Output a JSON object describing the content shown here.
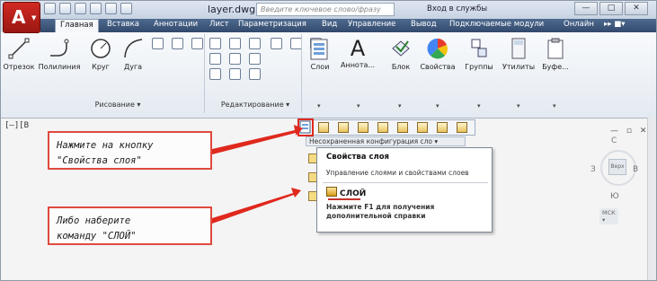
{
  "app": {
    "logo_letter": "A",
    "document_title": "layer.dwg",
    "search_placeholder": "Введите ключевое слово/фразу",
    "sign_in": "Вход в службы",
    "window_controls": [
      "—",
      "□",
      "✕"
    ]
  },
  "tabs": [
    {
      "label": "Главная",
      "active": true
    },
    {
      "label": "Вставка"
    },
    {
      "label": "Аннотации"
    },
    {
      "label": "Лист"
    },
    {
      "label": "Параметризация"
    },
    {
      "label": "Вид"
    },
    {
      "label": "Управление"
    },
    {
      "label": "Вывод"
    },
    {
      "label": "Подключаемые модули"
    },
    {
      "label": "Онлайн"
    }
  ],
  "ribbon": {
    "draw_tools": [
      "Отрезок",
      "Полилиния",
      "Круг",
      "Дуга"
    ],
    "draw_group_label": "Рисование ▾",
    "edit_group_label": "Редактирование ▾",
    "big_tools": [
      "Слои",
      "Аннота...",
      "Блок",
      "Свойства",
      "Группы",
      "Утилиты",
      "Буфе..."
    ],
    "icons": {
      "line": "line-icon",
      "polyline": "polyline-icon",
      "circle": "circle-icon",
      "arc": "arc-icon",
      "layers": "layers-icon",
      "annotation": "text-a-icon",
      "block": "block-icon",
      "properties": "color-wheel-icon",
      "groups": "groups-icon",
      "utilities": "calculator-icon",
      "clipboard": "clipboard-icon"
    }
  },
  "drawing": {
    "corner_label": "[–][В",
    "viewcube": {
      "top": "С",
      "left": "З",
      "right": "В",
      "bottom": "Ю",
      "face": "Верх",
      "ucs": "МСК ▾"
    }
  },
  "layer_panel": {
    "unsaved_config": "Несохраненная конфигурация сло ▾",
    "tooltip_title": "Свойства слоя",
    "tooltip_desc": "Управление слоями и свойствами слоев",
    "command": "СЛОЙ",
    "help_text": "Нажмите F1 для получения дополнительной справки"
  },
  "callouts": {
    "first": "Нажмите на кнопку\n\"Свойства слоя\"",
    "second": "Либо наберите\nкоманду \"СЛОЙ\""
  },
  "colors": {
    "accent": "#e0281d",
    "ribbon_tabs": "#3c5579",
    "app_button": "#c0251e"
  }
}
